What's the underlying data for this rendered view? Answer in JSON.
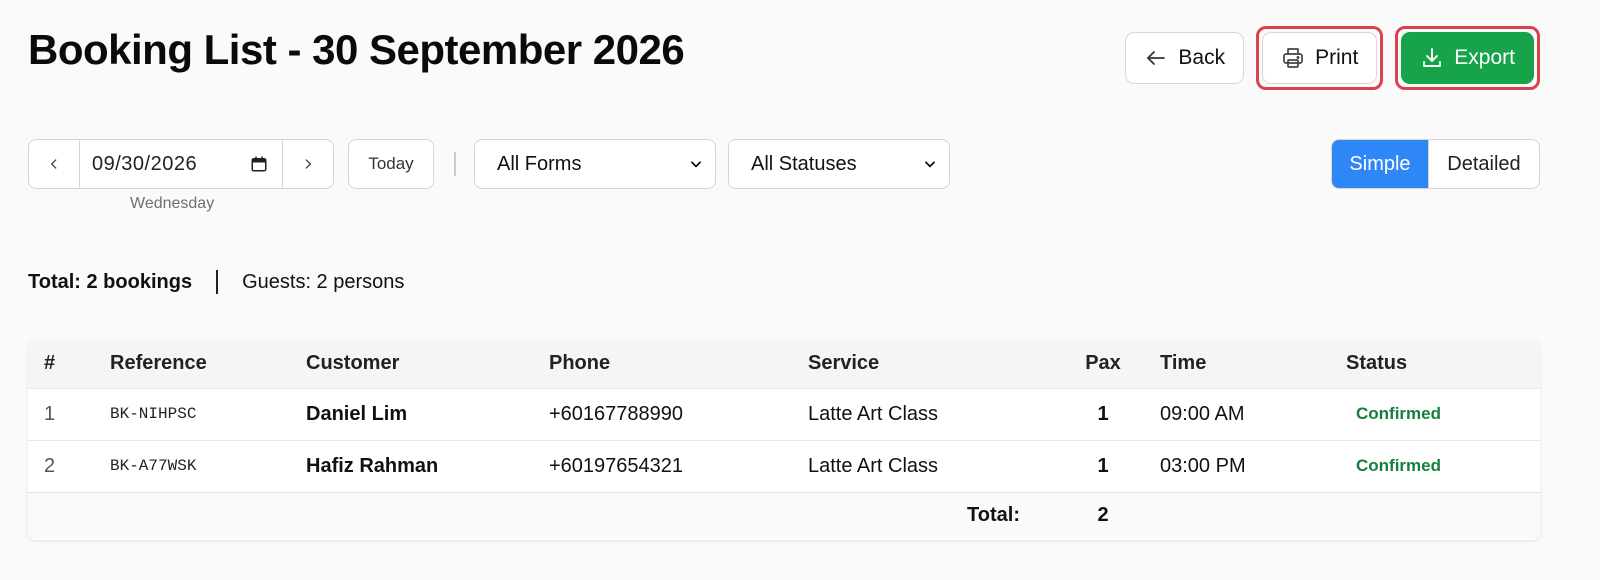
{
  "page": {
    "title": "Booking List - 30 September 2026"
  },
  "actions": {
    "back_label": "Back",
    "print_label": "Print",
    "export_label": "Export"
  },
  "date_nav": {
    "prev_icon": "chevron-left-icon",
    "date_value": "09/30/2026",
    "next_icon": "chevron-right-icon",
    "weekday": "Wednesday",
    "today_label": "Today"
  },
  "filters": {
    "forms_selected": "All Forms",
    "status_selected": "All Statuses"
  },
  "view": {
    "simple_label": "Simple",
    "detailed_label": "Detailed",
    "active": "Simple"
  },
  "summary": {
    "total_text": "Total: 2 bookings",
    "guests_text": "Guests: 2 persons"
  },
  "table": {
    "headers": {
      "num": "#",
      "reference": "Reference",
      "customer": "Customer",
      "phone": "Phone",
      "service": "Service",
      "pax": "Pax",
      "time": "Time",
      "status": "Status"
    },
    "rows": [
      {
        "num": "1",
        "reference": "BK-NIHPSC",
        "customer": "Daniel Lim",
        "phone": "+60167788990",
        "service": "Latte Art Class",
        "pax": "1",
        "time": "09:00 AM",
        "status": "Confirmed"
      },
      {
        "num": "2",
        "reference": "BK-A77WSK",
        "customer": "Hafiz Rahman",
        "phone": "+60197654321",
        "service": "Latte Art Class",
        "pax": "1",
        "time": "03:00 PM",
        "status": "Confirmed"
      }
    ],
    "footer": {
      "label": "Total:",
      "pax_total": "2"
    }
  },
  "colors": {
    "primary": "#2f86f6",
    "export": "#16a34a",
    "status_confirmed": "#15803d",
    "highlight_border": "#d9434f"
  }
}
